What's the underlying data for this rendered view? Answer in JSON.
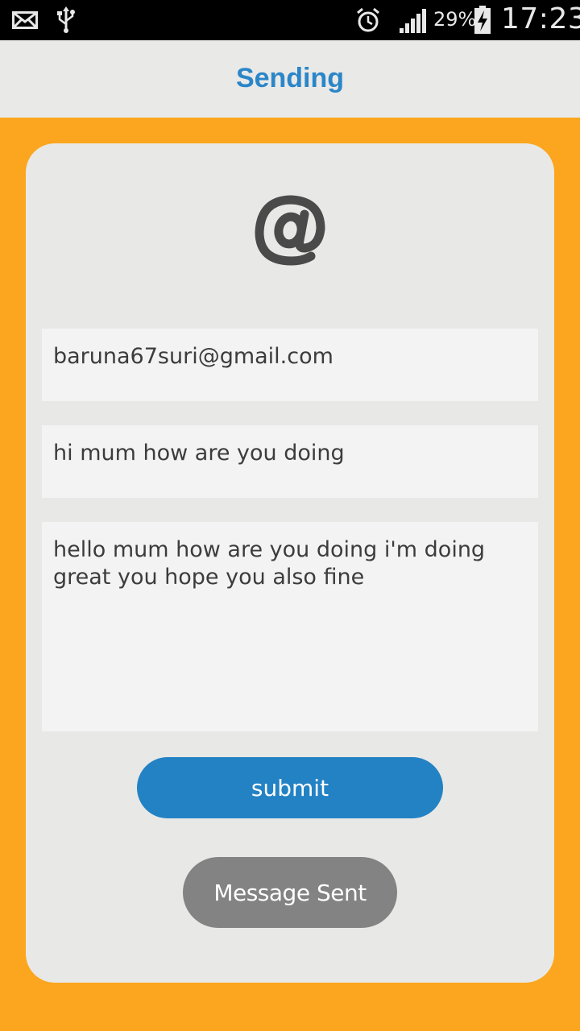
{
  "status_bar": {
    "icons": [
      "mail-icon",
      "usb-icon",
      "alarm-icon",
      "signal-icon",
      "battery-charging-icon"
    ],
    "battery_percent": "29%",
    "time": "17:23"
  },
  "header": {
    "title": "Sending"
  },
  "form": {
    "icon": "at-sign-icon",
    "email": "baruna67suri@gmail.com",
    "subject": "hi mum how are you doing",
    "message": "hello mum how are you doing i'm doing great you hope you also fine",
    "submit_label": "submit"
  },
  "toast": {
    "text": "Message Sent"
  },
  "colors": {
    "background": "#FBA61E",
    "title": "#2B86C8",
    "submit_button": "#2382C4",
    "toast": "#838383",
    "card": "#E8E8E6"
  }
}
